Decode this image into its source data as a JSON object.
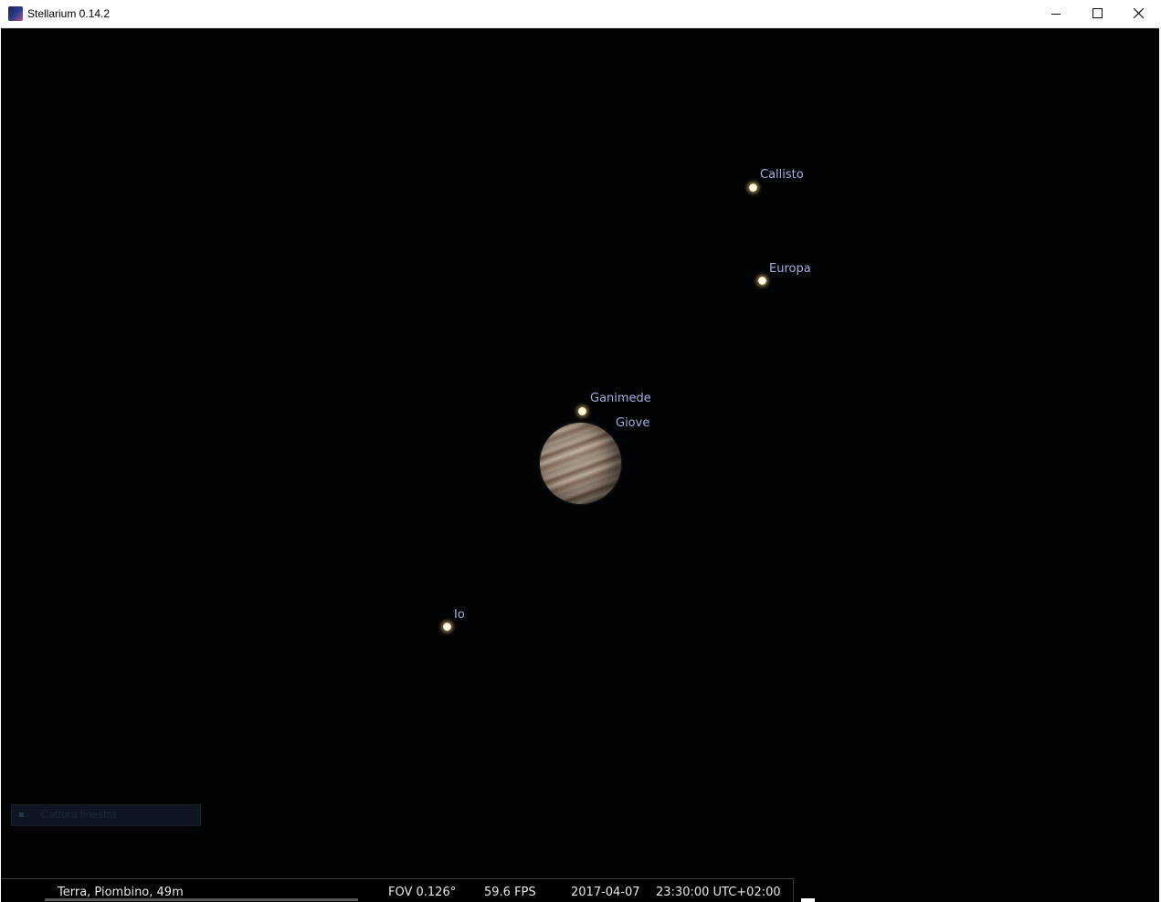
{
  "window": {
    "title": "Stellarium 0.14.2",
    "controls": {
      "minimize": "minimize-icon",
      "maximize": "maximize-icon",
      "close": "close-icon"
    }
  },
  "sky": {
    "background": "#020305",
    "objects": [
      {
        "id": "callisto",
        "label": "Callisto"
      },
      {
        "id": "europa",
        "label": "Europa"
      },
      {
        "id": "ganimede",
        "label": "Ganimede"
      },
      {
        "id": "giove",
        "label": "Giove"
      },
      {
        "id": "io",
        "label": "Io"
      }
    ]
  },
  "capture_panel": {
    "label": "Cattura finestra"
  },
  "status_bar": {
    "location": "Terra, Piombino, 49m",
    "fov": "FOV 0.126°",
    "fps": "59.6 FPS",
    "date": "2017-04-07",
    "time": "23:30:00 UTC+02:00"
  },
  "colors": {
    "label": "#a4aedb",
    "status_text": "#e8e8e8"
  }
}
